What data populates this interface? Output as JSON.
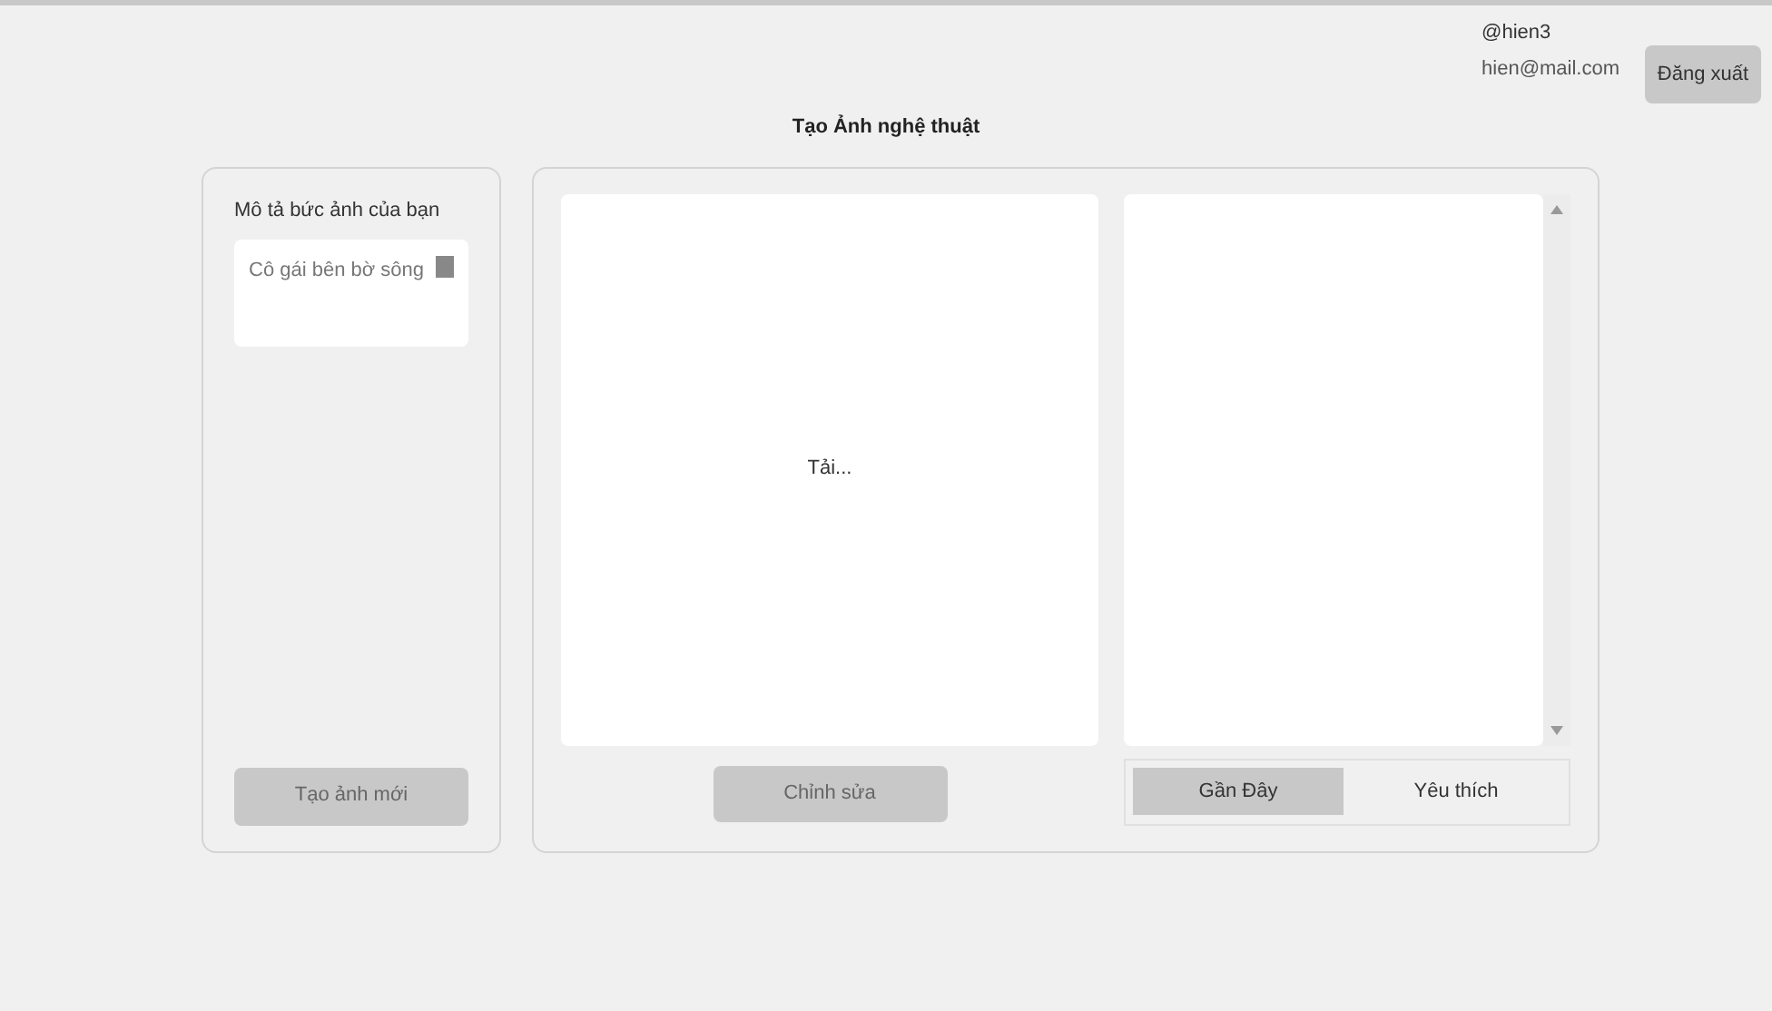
{
  "user": {
    "handle": "@hien3",
    "email": "hien@mail.com"
  },
  "logout_button": "Đăng xuất",
  "title": "Tạo Ảnh nghệ thuật",
  "prompt_panel": {
    "label": "Mô tả bức ảnh của bạn",
    "field": {
      "value": "Cô gái bên bờ sông"
    },
    "create_button": {
      "label": "Tạo ảnh mới",
      "disabled": true
    }
  },
  "canvas": {
    "status": "Tải..."
  },
  "edit_button": {
    "label": "Chỉnh sửa",
    "disabled": true
  },
  "gallery_tabs": [
    {
      "label": "Gần Đây",
      "selected": true
    },
    {
      "label": "Yêu thích",
      "selected": false
    }
  ]
}
